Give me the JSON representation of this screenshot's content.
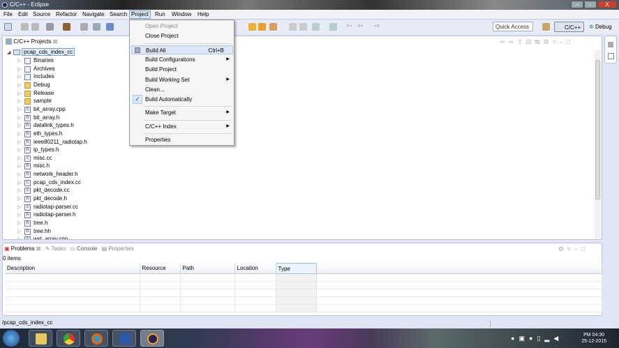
{
  "window": {
    "title": "C/C++ - Eclipse",
    "min": "–",
    "max": "▫",
    "close": "X"
  },
  "menubar": [
    "File",
    "Edit",
    "Source",
    "Refactor",
    "Navigate",
    "Search",
    "Project",
    "Run",
    "Window",
    "Help"
  ],
  "toolbar": {
    "quick_access": "Quick Access",
    "perspectives": [
      "C/C++",
      "Debug"
    ]
  },
  "explorer": {
    "tab": "C/C++ Projects",
    "root": "pcap_cds_index_cc",
    "items": [
      {
        "label": "Binaries",
        "icon": "binaries"
      },
      {
        "label": "Archives",
        "icon": "archives"
      },
      {
        "label": "Includes",
        "icon": "includes"
      },
      {
        "label": "Debug",
        "icon": "folder"
      },
      {
        "label": "Release",
        "icon": "folder"
      },
      {
        "label": "sample",
        "icon": "folder"
      },
      {
        "label": "bit_array.cpp",
        "icon": "c"
      },
      {
        "label": "bit_array.h",
        "icon": "h"
      },
      {
        "label": "datalink_types.h",
        "icon": "h"
      },
      {
        "label": "eth_types.h",
        "icon": "h"
      },
      {
        "label": "ieee80211_radiotap.h",
        "icon": "h"
      },
      {
        "label": "ip_types.h",
        "icon": "h"
      },
      {
        "label": "misc.cc",
        "icon": "c"
      },
      {
        "label": "misc.h",
        "icon": "h"
      },
      {
        "label": "network_header.h",
        "icon": "h"
      },
      {
        "label": "pcap_cds_index.cc",
        "icon": "c"
      },
      {
        "label": "pkt_decode.cc",
        "icon": "c"
      },
      {
        "label": "pkt_decode.h",
        "icon": "h"
      },
      {
        "label": "radiotap-parser.cc",
        "icon": "c"
      },
      {
        "label": "radiotap-parser.h",
        "icon": "h"
      },
      {
        "label": "tree.h",
        "icon": "h"
      },
      {
        "label": "tree.hh",
        "icon": "h"
      },
      {
        "label": "wst_array.cpp",
        "icon": "c"
      }
    ]
  },
  "project_menu": [
    {
      "label": "Open Project",
      "disabled": true
    },
    {
      "label": "Close Project"
    },
    {
      "sep": true
    },
    {
      "label": "Build All",
      "shortcut": "Ctrl+B",
      "highlighted": true
    },
    {
      "label": "Build Configurations",
      "submenu": true
    },
    {
      "label": "Build Project"
    },
    {
      "label": "Build Working Set",
      "submenu": true
    },
    {
      "label": "Clean..."
    },
    {
      "label": "Build Automatically",
      "checked": true
    },
    {
      "sep": true
    },
    {
      "label": "Make Target",
      "submenu": true
    },
    {
      "sep": true
    },
    {
      "label": "C/C++ Index",
      "submenu": true
    },
    {
      "sep": true
    },
    {
      "label": "Properties"
    }
  ],
  "problems": {
    "tabs": [
      "Problems",
      "Tasks",
      "Console",
      "Properties"
    ],
    "count": "0 items",
    "columns": [
      "Description",
      "Resource",
      "Path",
      "Location",
      "Type"
    ]
  },
  "status": "/pcap_cds_index_cc",
  "clock": {
    "time": "PM 04:30",
    "date": "25-12-2015"
  }
}
